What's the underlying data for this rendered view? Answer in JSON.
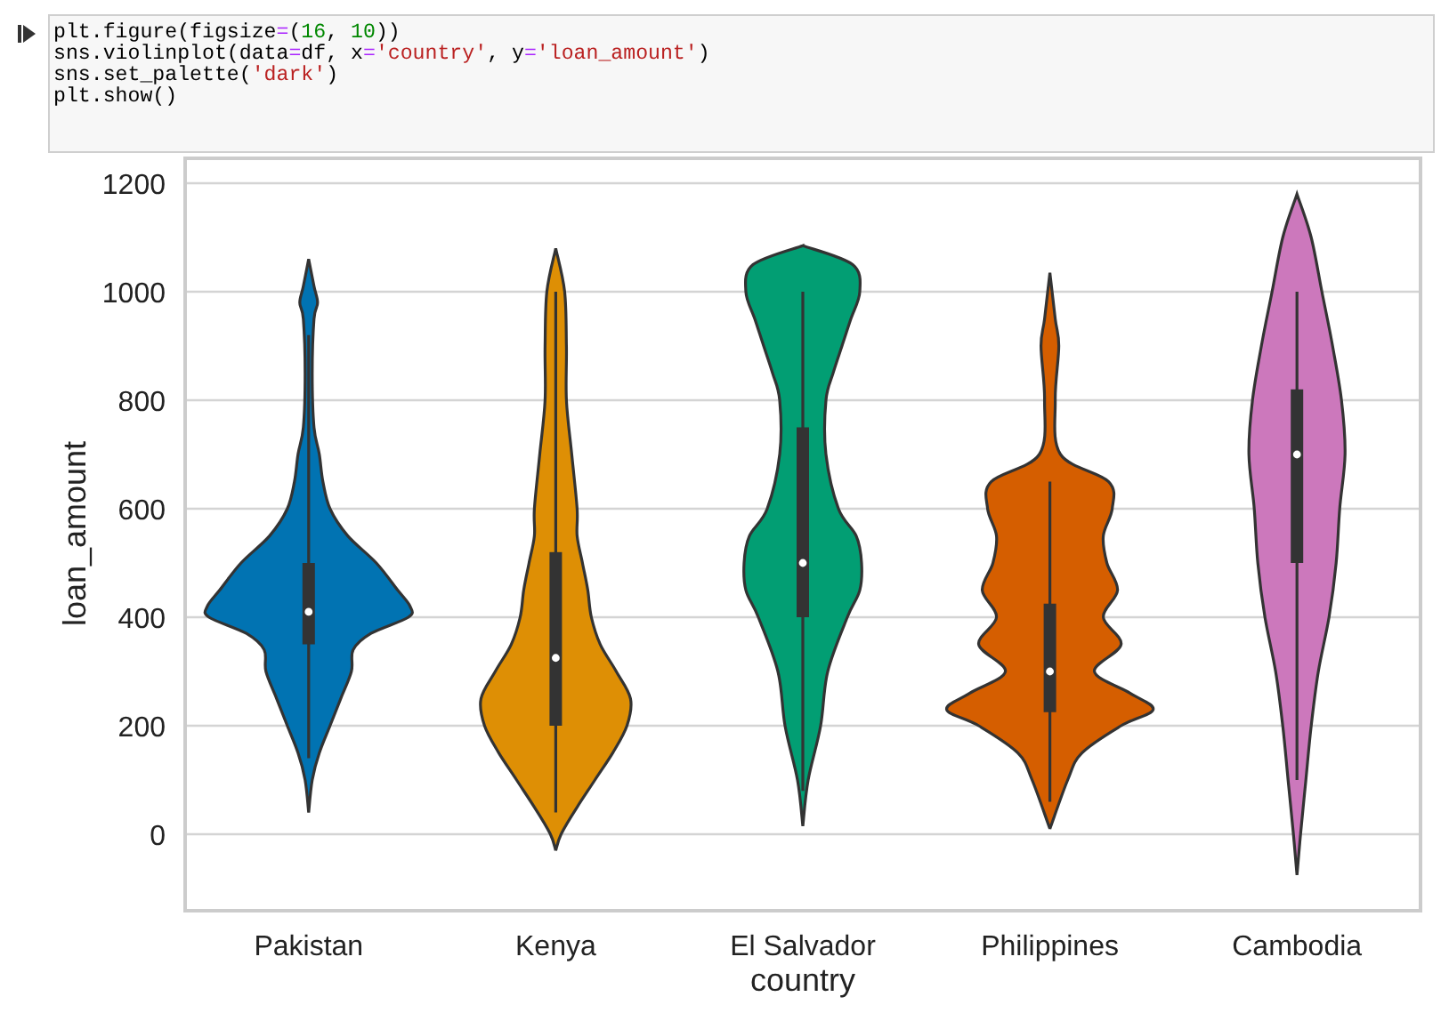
{
  "cell": {
    "code": [
      "plt.figure(figsize=(16, 10))",
      "sns.violinplot(data=df, x='country', y='loan_amount')",
      "sns.set_palette('dark')",
      "plt.show()"
    ]
  },
  "plot": {
    "ylabel": "loan_amount",
    "xlabel": "country",
    "yticks": [
      "1200",
      "1000",
      "800",
      "600",
      "400",
      "200",
      "0"
    ],
    "categories": [
      {
        "name": "Pakistan",
        "color": "#0173b2"
      },
      {
        "name": "Kenya",
        "color": "#de8f05"
      },
      {
        "name": "El Salvador",
        "color": "#029e73"
      },
      {
        "name": "Philippines",
        "color": "#d55e00"
      },
      {
        "name": "Cambodia",
        "color": "#cc78bc"
      }
    ]
  }
}
